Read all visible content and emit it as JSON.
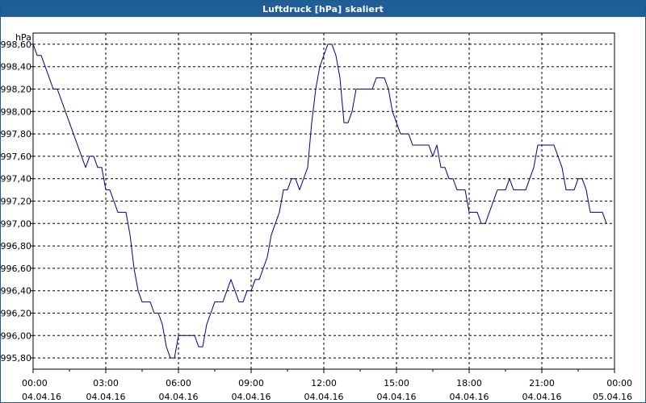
{
  "window": {
    "title": "Luftdruck [hPa] skaliert"
  },
  "colors": {
    "line": "#00008b",
    "grid": "#000000",
    "titlebar": "#1f5e96"
  },
  "chart_data": {
    "type": "line",
    "title": "Luftdruck [hPa] skaliert",
    "ylabel": "hPa",
    "xlabel": "",
    "ylim": [
      995.7,
      998.7
    ],
    "y_ticks": [
      995.8,
      996.0,
      996.2,
      996.4,
      996.6,
      996.8,
      997.0,
      997.2,
      997.4,
      997.6,
      997.8,
      998.0,
      998.2,
      998.4,
      998.6
    ],
    "y_tick_labels": [
      "995,80",
      "996,00",
      "996,20",
      "996,40",
      "996,60",
      "996,80",
      "997,00",
      "997,20",
      "997,40",
      "997,60",
      "997,80",
      "998,00",
      "998,20",
      "998,40",
      "998,60"
    ],
    "xlim": [
      "04.04.16 00:00",
      "05.04.16 00:00"
    ],
    "x_ticks": [
      {
        "time": "00:00",
        "date": "04.04.16"
      },
      {
        "time": "03:00",
        "date": "04.04.16"
      },
      {
        "time": "06:00",
        "date": "04.04.16"
      },
      {
        "time": "09:00",
        "date": "04.04.16"
      },
      {
        "time": "12:00",
        "date": "04.04.16"
      },
      {
        "time": "15:00",
        "date": "04.04.16"
      },
      {
        "time": "18:00",
        "date": "04.04.16"
      },
      {
        "time": "21:00",
        "date": "04.04.16"
      },
      {
        "time": "00:00",
        "date": "05.04.16"
      }
    ],
    "grid": true,
    "series": [
      {
        "points": [
          [
            "00:00",
            998.6
          ],
          [
            "00:10",
            998.5
          ],
          [
            "00:20",
            998.5
          ],
          [
            "00:30",
            998.4
          ],
          [
            "00:40",
            998.3
          ],
          [
            "00:50",
            998.2
          ],
          [
            "01:00",
            998.2
          ],
          [
            "01:10",
            998.1
          ],
          [
            "01:20",
            998.0
          ],
          [
            "01:30",
            997.9
          ],
          [
            "01:40",
            997.8
          ],
          [
            "01:50",
            997.7
          ],
          [
            "02:00",
            997.6
          ],
          [
            "02:10",
            997.5
          ],
          [
            "02:20",
            997.6
          ],
          [
            "02:30",
            997.6
          ],
          [
            "02:40",
            997.5
          ],
          [
            "02:50",
            997.5
          ],
          [
            "03:00",
            997.3
          ],
          [
            "03:10",
            997.3
          ],
          [
            "03:20",
            997.2
          ],
          [
            "03:30",
            997.1
          ],
          [
            "03:40",
            997.1
          ],
          [
            "03:50",
            997.1
          ],
          [
            "04:00",
            996.9
          ],
          [
            "04:10",
            996.6
          ],
          [
            "04:20",
            996.4
          ],
          [
            "04:30",
            996.3
          ],
          [
            "04:40",
            996.3
          ],
          [
            "04:50",
            996.3
          ],
          [
            "05:00",
            996.2
          ],
          [
            "05:10",
            996.2
          ],
          [
            "05:20",
            996.1
          ],
          [
            "05:30",
            995.9
          ],
          [
            "05:40",
            995.8
          ],
          [
            "05:50",
            995.8
          ],
          [
            "06:00",
            996.0
          ],
          [
            "06:10",
            996.0
          ],
          [
            "06:20",
            996.0
          ],
          [
            "06:30",
            996.0
          ],
          [
            "06:40",
            996.0
          ],
          [
            "06:50",
            995.9
          ],
          [
            "07:00",
            995.9
          ],
          [
            "07:10",
            996.1
          ],
          [
            "07:20",
            996.2
          ],
          [
            "07:30",
            996.3
          ],
          [
            "07:40",
            996.3
          ],
          [
            "07:50",
            996.3
          ],
          [
            "08:00",
            996.4
          ],
          [
            "08:10",
            996.5
          ],
          [
            "08:20",
            996.4
          ],
          [
            "08:30",
            996.3
          ],
          [
            "08:40",
            996.3
          ],
          [
            "08:50",
            996.4
          ],
          [
            "09:00",
            996.4
          ],
          [
            "09:10",
            996.5
          ],
          [
            "09:20",
            996.5
          ],
          [
            "09:30",
            996.6
          ],
          [
            "09:40",
            996.7
          ],
          [
            "09:50",
            996.9
          ],
          [
            "10:00",
            997.0
          ],
          [
            "10:10",
            997.1
          ],
          [
            "10:20",
            997.3
          ],
          [
            "10:30",
            997.3
          ],
          [
            "10:40",
            997.4
          ],
          [
            "10:50",
            997.4
          ],
          [
            "11:00",
            997.3
          ],
          [
            "11:10",
            997.4
          ],
          [
            "11:20",
            997.5
          ],
          [
            "11:30",
            997.9
          ],
          [
            "11:40",
            998.2
          ],
          [
            "11:50",
            998.4
          ],
          [
            "12:00",
            998.5
          ],
          [
            "12:10",
            998.6
          ],
          [
            "12:20",
            998.6
          ],
          [
            "12:30",
            998.5
          ],
          [
            "12:40",
            998.3
          ],
          [
            "12:50",
            997.9
          ],
          [
            "13:00",
            997.9
          ],
          [
            "13:10",
            998.0
          ],
          [
            "13:20",
            998.2
          ],
          [
            "13:30",
            998.2
          ],
          [
            "13:40",
            998.2
          ],
          [
            "13:50",
            998.2
          ],
          [
            "14:00",
            998.2
          ],
          [
            "14:10",
            998.3
          ],
          [
            "14:20",
            998.3
          ],
          [
            "14:30",
            998.3
          ],
          [
            "14:40",
            998.2
          ],
          [
            "14:50",
            998.0
          ],
          [
            "15:00",
            997.9
          ],
          [
            "15:10",
            997.8
          ],
          [
            "15:20",
            997.8
          ],
          [
            "15:30",
            997.8
          ],
          [
            "15:40",
            997.7
          ],
          [
            "15:50",
            997.7
          ],
          [
            "16:00",
            997.7
          ],
          [
            "16:10",
            997.7
          ],
          [
            "16:20",
            997.7
          ],
          [
            "16:30",
            997.6
          ],
          [
            "16:40",
            997.7
          ],
          [
            "16:50",
            997.5
          ],
          [
            "17:00",
            997.5
          ],
          [
            "17:10",
            997.4
          ],
          [
            "17:20",
            997.4
          ],
          [
            "17:30",
            997.3
          ],
          [
            "17:40",
            997.3
          ],
          [
            "17:50",
            997.3
          ],
          [
            "18:00",
            997.1
          ],
          [
            "18:10",
            997.1
          ],
          [
            "18:20",
            997.1
          ],
          [
            "18:30",
            997.0
          ],
          [
            "18:40",
            997.0
          ],
          [
            "18:50",
            997.1
          ],
          [
            "19:00",
            997.2
          ],
          [
            "19:10",
            997.3
          ],
          [
            "19:20",
            997.3
          ],
          [
            "19:30",
            997.3
          ],
          [
            "19:40",
            997.4
          ],
          [
            "19:50",
            997.3
          ],
          [
            "20:00",
            997.3
          ],
          [
            "20:10",
            997.3
          ],
          [
            "20:20",
            997.3
          ],
          [
            "20:30",
            997.4
          ],
          [
            "20:40",
            997.5
          ],
          [
            "20:50",
            997.7
          ],
          [
            "21:00",
            997.7
          ],
          [
            "21:10",
            997.7
          ],
          [
            "21:20",
            997.7
          ],
          [
            "21:30",
            997.7
          ],
          [
            "21:40",
            997.6
          ],
          [
            "21:50",
            997.5
          ],
          [
            "22:00",
            997.3
          ],
          [
            "22:10",
            997.3
          ],
          [
            "22:20",
            997.3
          ],
          [
            "22:30",
            997.4
          ],
          [
            "22:40",
            997.4
          ],
          [
            "22:50",
            997.3
          ],
          [
            "23:00",
            997.1
          ],
          [
            "23:10",
            997.1
          ],
          [
            "23:20",
            997.1
          ],
          [
            "23:30",
            997.1
          ],
          [
            "23:40",
            997.0
          ]
        ]
      }
    ]
  }
}
